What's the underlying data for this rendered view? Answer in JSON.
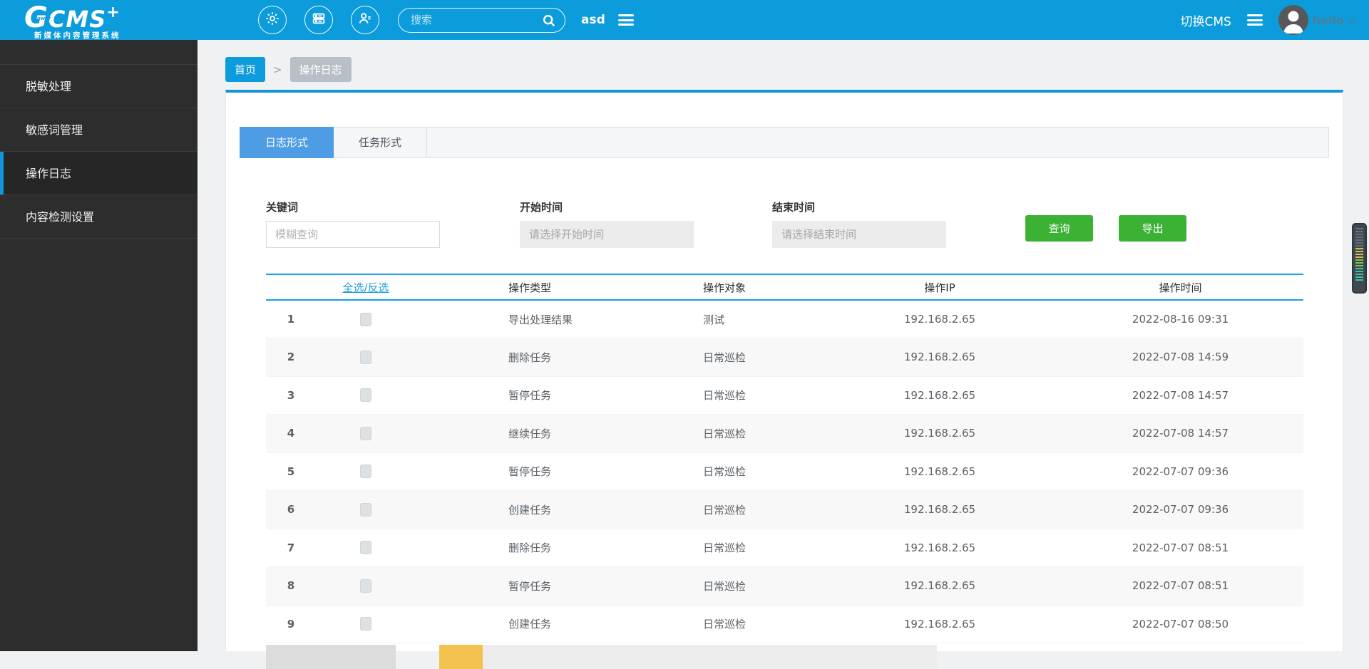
{
  "header": {
    "logo": {
      "g": "G",
      "cms": "CMS",
      "plus": "+",
      "power": "power",
      "subtitle": "新媒体内容管理系统"
    },
    "search": {
      "placeholder": "搜索",
      "value": ""
    },
    "username_left": "asd",
    "switch_cms_label": "切换CMS",
    "user_menu": {
      "name": "hello"
    }
  },
  "sidebar": {
    "items": [
      {
        "label": "脱敏处理",
        "active": false
      },
      {
        "label": "敏感词管理",
        "active": false
      },
      {
        "label": "操作日志",
        "active": true
      },
      {
        "label": "内容检测设置",
        "active": false
      }
    ]
  },
  "breadcrumb": {
    "home": "首页",
    "separator": ">",
    "current": "操作日志"
  },
  "tabs": [
    {
      "label": "日志形式",
      "active": true
    },
    {
      "label": "任务形式",
      "active": false
    }
  ],
  "filters": {
    "keyword": {
      "label": "关键词",
      "placeholder": "模糊查询",
      "value": ""
    },
    "start_time": {
      "label": "开始时间",
      "placeholder": "请选择开始时间",
      "value": ""
    },
    "end_time": {
      "label": "结束时间",
      "placeholder": "请选择结束时间",
      "value": ""
    },
    "query_button": "查询",
    "export_button": "导出"
  },
  "table": {
    "select_all_label": "全选/反选",
    "columns": [
      "操作类型",
      "操作对象",
      "操作IP",
      "操作时间"
    ],
    "rows": [
      {
        "index": "1",
        "type": "导出处理结果",
        "object": "测试",
        "ip": "192.168.2.65",
        "time": "2022-08-16 09:31"
      },
      {
        "index": "2",
        "type": "删除任务",
        "object": "日常巡检",
        "ip": "192.168.2.65",
        "time": "2022-07-08 14:59"
      },
      {
        "index": "3",
        "type": "暂停任务",
        "object": "日常巡检",
        "ip": "192.168.2.65",
        "time": "2022-07-08 14:57"
      },
      {
        "index": "4",
        "type": "继续任务",
        "object": "日常巡检",
        "ip": "192.168.2.65",
        "time": "2022-07-08 14:57"
      },
      {
        "index": "5",
        "type": "暂停任务",
        "object": "日常巡检",
        "ip": "192.168.2.65",
        "time": "2022-07-07 09:36"
      },
      {
        "index": "6",
        "type": "创建任务",
        "object": "日常巡检",
        "ip": "192.168.2.65",
        "time": "2022-07-07 09:36"
      },
      {
        "index": "7",
        "type": "删除任务",
        "object": "日常巡检",
        "ip": "192.168.2.65",
        "time": "2022-07-07 08:51"
      },
      {
        "index": "8",
        "type": "暂停任务",
        "object": "日常巡检",
        "ip": "192.168.2.65",
        "time": "2022-07-07 08:51"
      },
      {
        "index": "9",
        "type": "创建任务",
        "object": "日常巡检",
        "ip": "192.168.2.65",
        "time": "2022-07-07 08:50"
      }
    ]
  },
  "colors": {
    "primary_blue": "#0d9cdb",
    "accent_blue": "#1296db",
    "tab_active_blue": "#4d9ce4",
    "button_green": "#3bb234",
    "sidebar_bg": "#2d2d2d",
    "breadcrumb_inactive_gray": "#b9bfc6",
    "pagination_accent_orange": "#f2c14e"
  }
}
